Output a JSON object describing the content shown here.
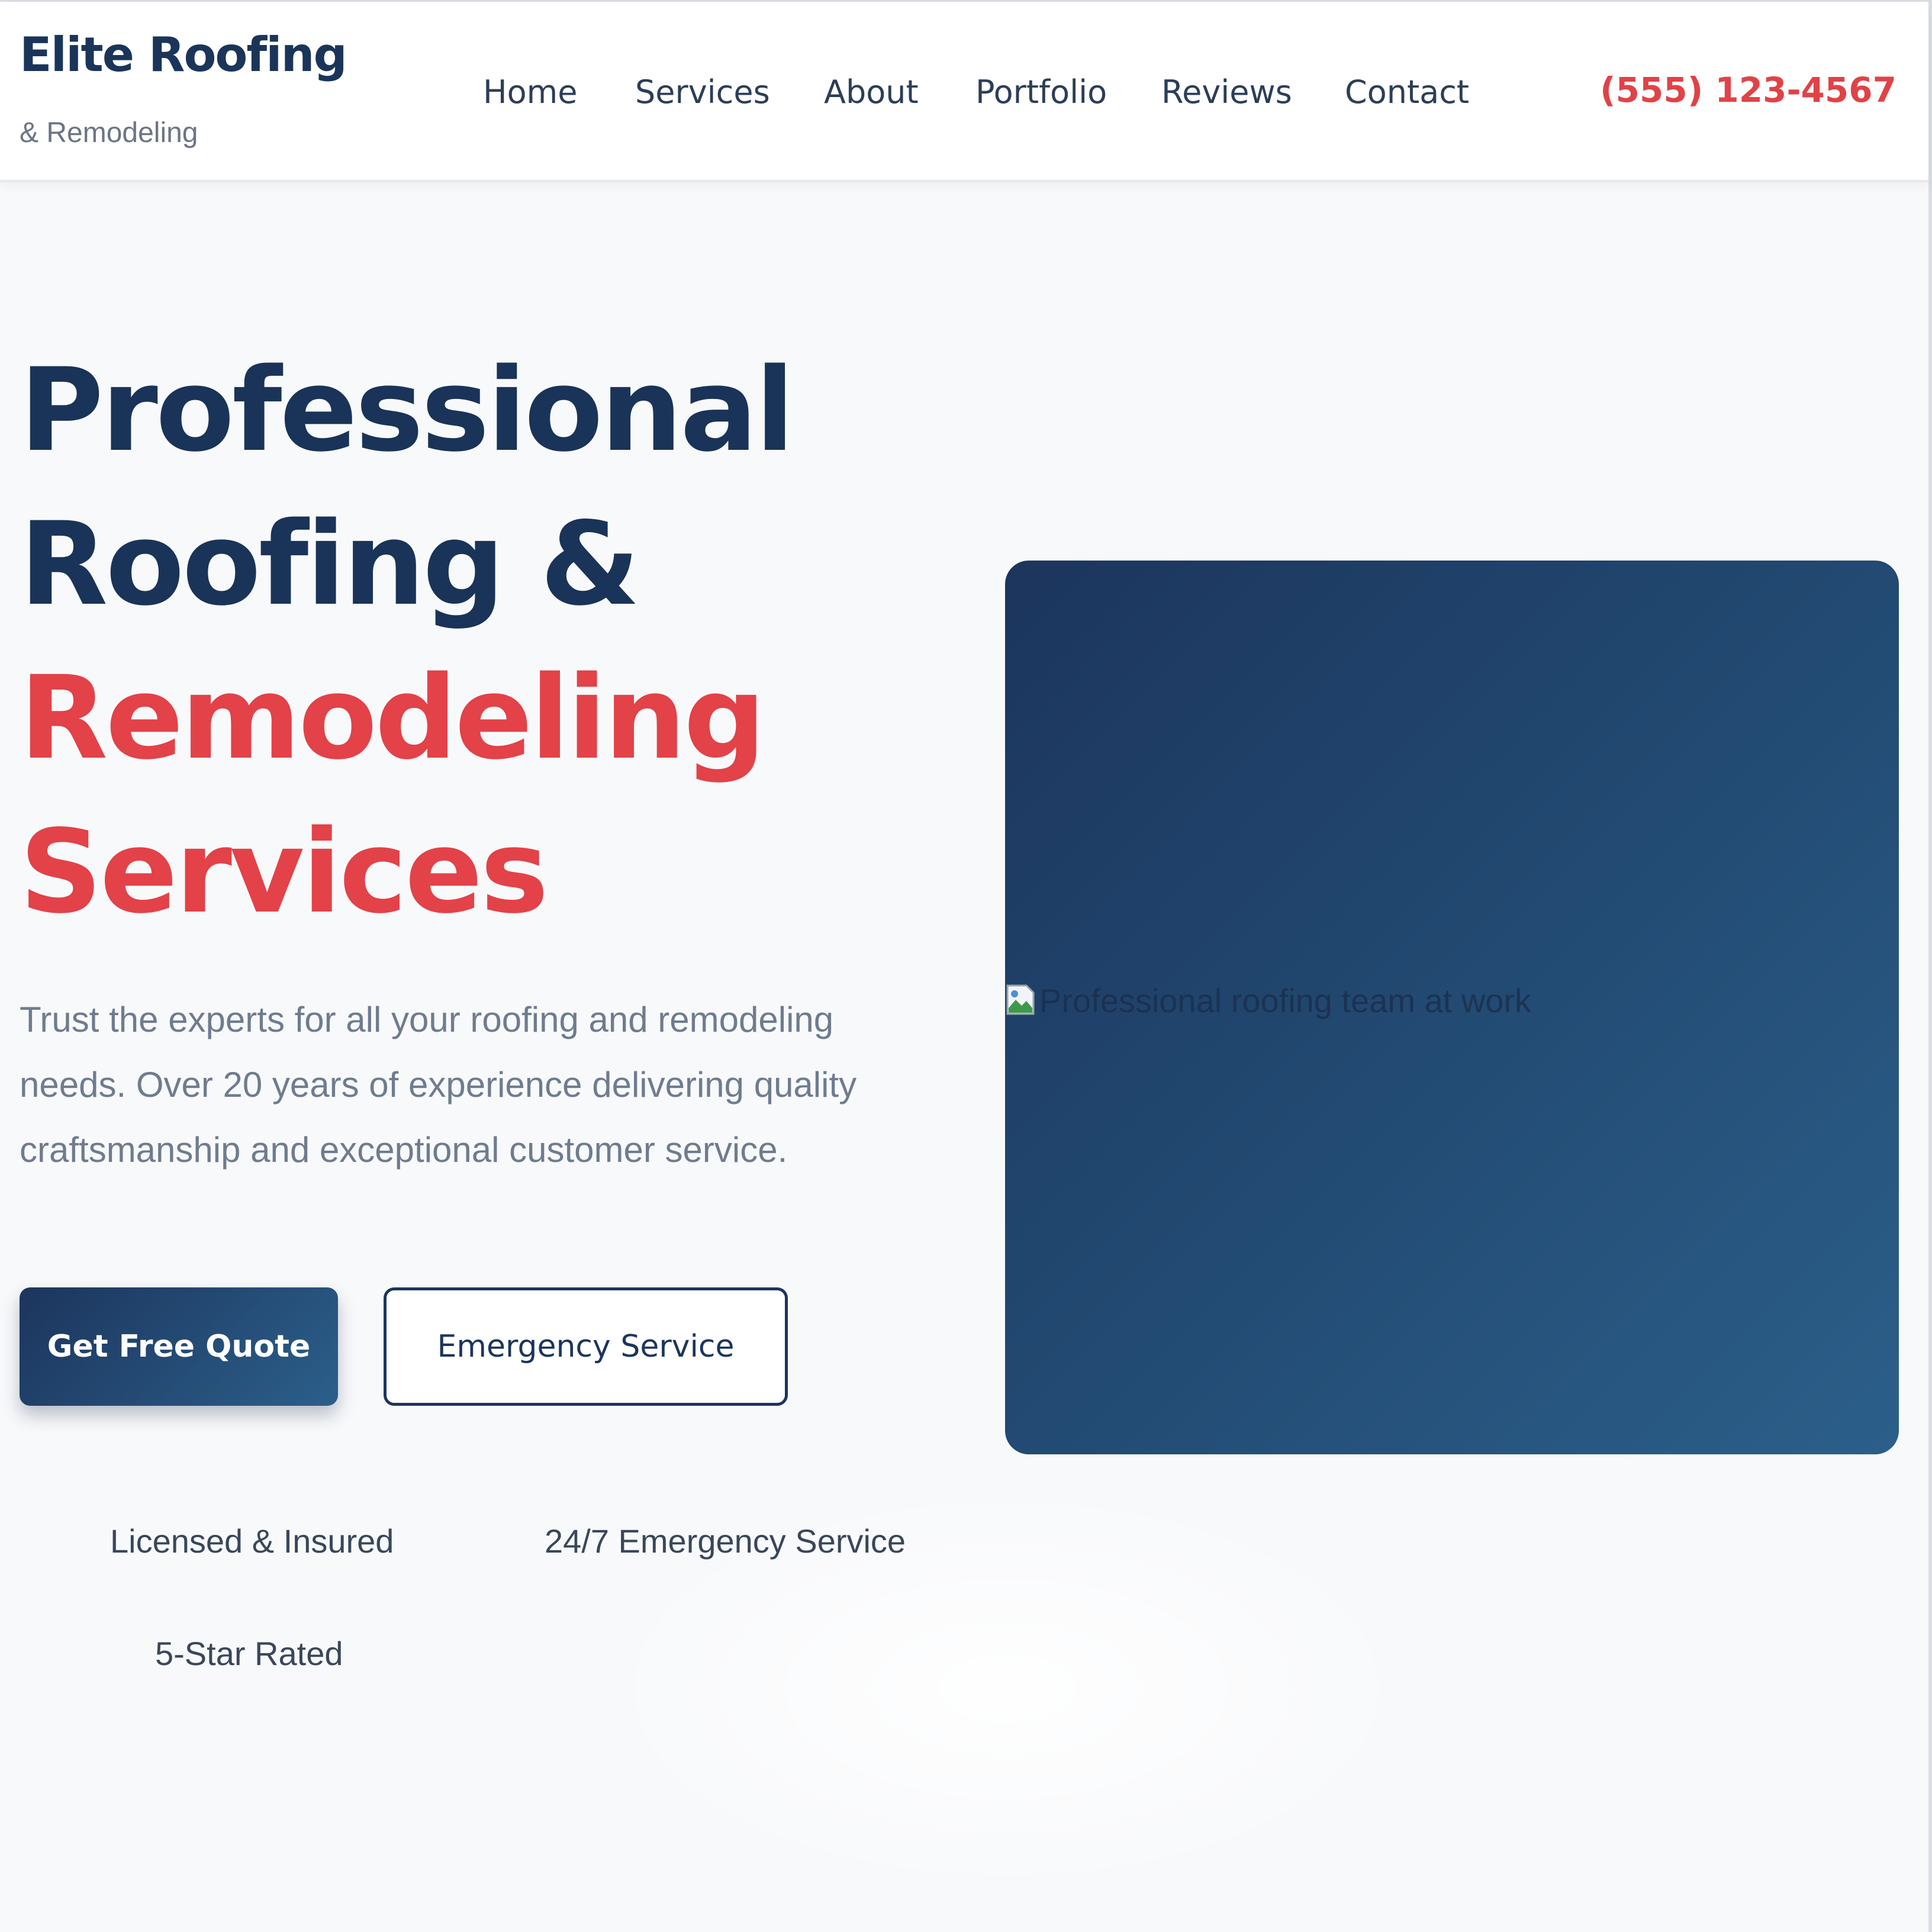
{
  "header": {
    "brand_name": "Elite Roofing",
    "brand_tagline": "& Remodeling",
    "nav": [
      "Home",
      "Services",
      "About",
      "Portfolio",
      "Reviews",
      "Contact"
    ],
    "phone": "(555) 123-4567"
  },
  "hero": {
    "title_line1": "Professional",
    "title_line2": "Roofing &",
    "title_line3": "Remodeling",
    "title_line4": "Services",
    "description": "Trust the experts for all your roofing and remodeling needs. Over 20 years of experience delivering quality craftsmanship and exceptional customer service.",
    "primary_button": "Get Free Quote",
    "secondary_button": "Emergency Service",
    "badges": [
      "Licensed & Insured",
      "24/7 Emergency Service",
      "5-Star Rated"
    ],
    "image_alt": "Professional roofing team at work",
    "broken_image_icon": "broken-image-icon"
  },
  "colors": {
    "brand_dark": "#1c355d",
    "brand_light": "#2b5f8a",
    "accent": "#e24248",
    "muted_text": "#6f7c8f",
    "background": "#f8f9fb"
  }
}
